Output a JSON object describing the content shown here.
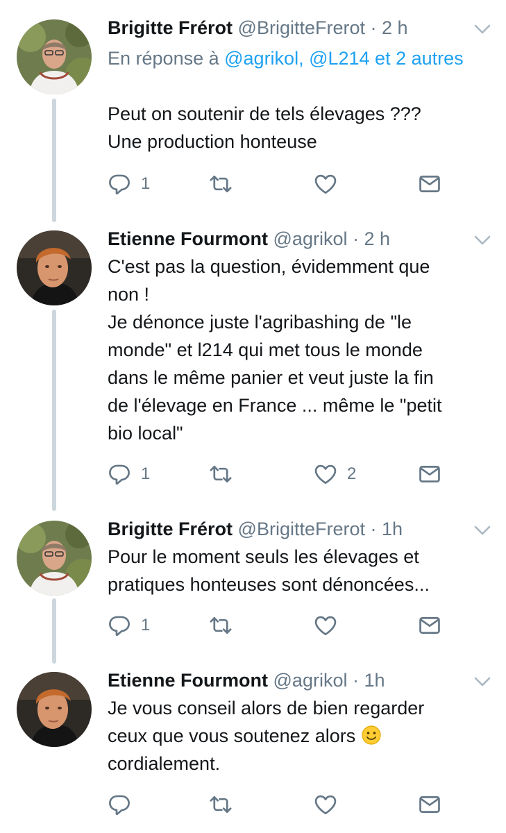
{
  "colors": {
    "link": "#1da1f2",
    "secondary": "#657786",
    "thread_line": "#ccd6dd"
  },
  "tweets": [
    {
      "name": "Brigitte Frérot",
      "handle": "@BrigitteFrerot",
      "dot": "·",
      "time": "2 h",
      "reply_prefix": "En réponse à ",
      "reply_mentions": "@agrikol, @L214 et 2 autres",
      "lines": [
        "Peut on soutenir de tels élevages ???",
        "Une production honteuse"
      ],
      "reply_count": "1",
      "like_count": ""
    },
    {
      "name": "Etienne Fourmont",
      "handle": "@agrikol",
      "dot": "·",
      "time": "2 h",
      "lines": [
        "C'est pas la question, évidemment que",
        "non !",
        "Je dénonce juste l'agribashing de \"le",
        "monde\" et l214 qui met tous le monde",
        "dans le même panier et veut juste la fin",
        "de l'élevage en France ... même le \"petit",
        "bio local\""
      ],
      "reply_count": "1",
      "like_count": "2"
    },
    {
      "name": "Brigitte Frérot",
      "handle": "@BrigitteFrerot",
      "dot": "·",
      "time": "1h",
      "lines": [
        "Pour le moment seuls les élevages et",
        "pratiques honteuses sont dénoncées..."
      ],
      "reply_count": "1",
      "like_count": ""
    },
    {
      "name": "Etienne Fourmont",
      "handle": "@agrikol",
      "dot": "·",
      "time": "1h",
      "lines": [
        "Je vous conseil alors de bien regarder",
        "ceux que vous soutenez alors",
        "cordialement."
      ],
      "reply_count": "",
      "like_count": ""
    }
  ]
}
